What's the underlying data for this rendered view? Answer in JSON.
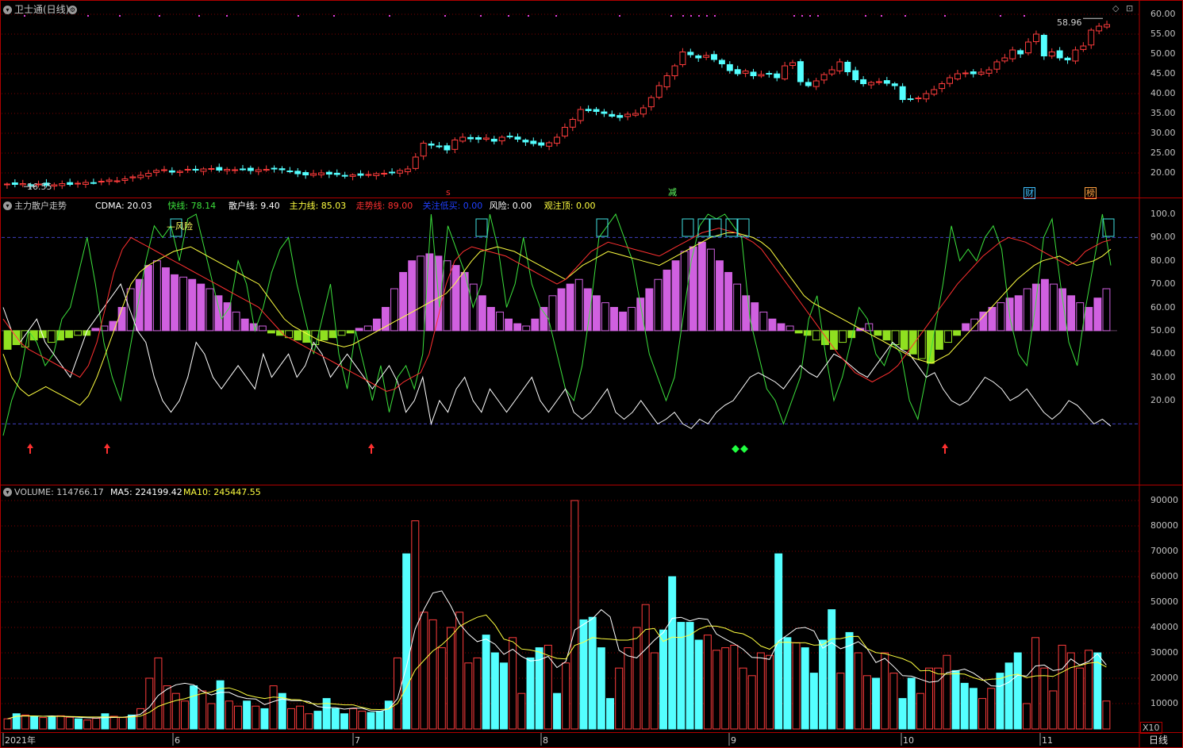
{
  "header": {
    "title": "卫士通(日线)",
    "diamond_icon": "diamond-icon",
    "gear_icon": "gear-icon",
    "max_price_label": "58.96",
    "min_price_label": "16.55"
  },
  "indicator": {
    "name": "主力散户走势",
    "values": [
      {
        "label": "CDMA: 20.03",
        "color": "#ffffff"
      },
      {
        "label": "快线: 78.14",
        "color": "#3ce03c"
      },
      {
        "label": "散户线: 9.40",
        "color": "#ffffff"
      },
      {
        "label": "主力线: 85.03",
        "color": "#ffff40"
      },
      {
        "label": "走势线: 89.00",
        "color": "#ff3030"
      },
      {
        "label": "关注低买: 0.00",
        "color": "#2040ff"
      },
      {
        "label": "风险: 0.00",
        "color": "#ffffff"
      },
      {
        "label": "观注顶: 0.00",
        "color": "#ffff40"
      }
    ],
    "risk_label": "风险"
  },
  "volume": {
    "name": "VOLUME: 114766.17",
    "ma5": "MA5: 224199.42",
    "ma10": "MA10: 245447.55",
    "unit": "X10"
  },
  "markers": {
    "s_label": "s",
    "jian_label": "减",
    "cai_label": "财",
    "bang_label": "榜"
  },
  "footer": {
    "period": "日线",
    "x_labels": [
      "2021年",
      "6",
      "7",
      "8",
      "9",
      "10",
      "11"
    ]
  },
  "colors": {
    "up": "#ff3c3c",
    "down": "#54ffff",
    "magenta": "#d060e0",
    "lime": "#90e020",
    "grid": "#800000",
    "frame": "#b00000"
  },
  "chart_data": [
    {
      "type": "candlestick",
      "title": "卫士通(日线)",
      "yticks": [
        "60.00",
        "55.00",
        "50.00",
        "45.00",
        "40.00",
        "35.00",
        "30.00",
        "25.00",
        "20.00"
      ],
      "ylim": [
        16.0,
        61.0
      ],
      "closes": [
        17.2,
        17.1,
        17.3,
        17.0,
        17.2,
        16.9,
        17.0,
        17.3,
        17.1,
        17.4,
        17.6,
        17.5,
        17.9,
        18.2,
        18.0,
        18.5,
        19.0,
        19.4,
        19.9,
        20.6,
        20.8,
        20.2,
        20.4,
        20.9,
        20.7,
        21.0,
        21.1,
        20.7,
        20.9,
        20.8,
        21.0,
        20.6,
        20.8,
        20.9,
        21.0,
        20.8,
        20.4,
        19.8,
        19.5,
        19.8,
        20.0,
        19.7,
        19.6,
        19.3,
        19.5,
        19.4,
        19.6,
        19.8,
        19.9,
        20.0,
        20.6,
        21.0,
        24.0,
        27.5,
        27.0,
        26.6,
        25.8,
        28.3,
        29.0,
        28.6,
        28.5,
        28.8,
        28.0,
        29.0,
        29.2,
        28.5,
        27.8,
        27.4,
        27.0,
        27.6,
        29.0,
        31.5,
        33.5,
        36.0,
        35.7,
        35.5,
        35.0,
        34.3,
        34.0,
        34.8,
        35.0,
        36.4,
        39.0,
        42.0,
        44.5,
        47.0,
        50.5,
        49.8,
        49.0,
        49.6,
        48.6,
        47.5,
        45.8,
        45.0,
        45.7,
        44.5,
        44.8,
        45.0,
        44.0,
        47.0,
        47.8,
        43.0,
        42.0,
        43.2,
        44.8,
        46.0,
        48.0,
        45.5,
        43.5,
        42.5,
        42.8,
        43.0,
        42.6,
        42.0,
        38.5,
        38.6,
        38.9,
        40.0,
        41.0,
        42.5,
        44.0,
        45.0,
        45.2,
        45.0,
        45.4,
        46.0,
        48.0,
        49.0,
        51.0,
        50.0,
        53.0,
        55.0,
        49.5,
        50.5,
        49.0,
        48.5,
        51.0,
        52.0,
        56.0,
        57.0,
        57.4
      ],
      "last_high": 58.96,
      "first_low": 16.55
    },
    {
      "type": "line",
      "title": "主力散户走势",
      "yticks": [
        "100.0",
        "90.00",
        "80.00",
        "70.00",
        "60.00",
        "50.00",
        "40.00",
        "30.00",
        "20.00"
      ],
      "ylim": [
        0,
        103
      ],
      "series": [
        {
          "name": "快线",
          "values": [
            5,
            20,
            30,
            50,
            45,
            35,
            40,
            55,
            60,
            75,
            90,
            70,
            45,
            30,
            20,
            40,
            60,
            80,
            95,
            90,
            95,
            80,
            98,
            100,
            85,
            70,
            55,
            60,
            80,
            70,
            50,
            60,
            75,
            85,
            90,
            70,
            55,
            40,
            55,
            70,
            40,
            25,
            50,
            35,
            20,
            35,
            15,
            30,
            35,
            25,
            40,
            100,
            60,
            95,
            85,
            75,
            60,
            70,
            100,
            85,
            60,
            70,
            90,
            70,
            60,
            55,
            40,
            25,
            20,
            35,
            60,
            90,
            95,
            100,
            90,
            80,
            60,
            40,
            30,
            20,
            30,
            55,
            80,
            95,
            100,
            98,
            100,
            95,
            90,
            55,
            40,
            25,
            20,
            10,
            20,
            30,
            55,
            65,
            40,
            20,
            30,
            45,
            60,
            55,
            40,
            35,
            45,
            40,
            20,
            12,
            30,
            50,
            70,
            95,
            80,
            85,
            80,
            90,
            95,
            85,
            55,
            40,
            35,
            60,
            90,
            98,
            70,
            45,
            35,
            60,
            80,
            100,
            78
          ]
        },
        {
          "name": "散户线",
          "values": [
            60,
            50,
            45,
            50,
            55,
            45,
            40,
            35,
            30,
            40,
            50,
            55,
            60,
            65,
            70,
            60,
            50,
            45,
            30,
            20,
            15,
            20,
            30,
            45,
            40,
            30,
            25,
            30,
            35,
            30,
            25,
            40,
            30,
            35,
            40,
            30,
            35,
            45,
            40,
            30,
            35,
            40,
            35,
            30,
            25,
            30,
            35,
            28,
            15,
            20,
            30,
            10,
            20,
            15,
            25,
            30,
            20,
            15,
            25,
            20,
            15,
            20,
            25,
            30,
            20,
            15,
            20,
            25,
            15,
            12,
            15,
            20,
            25,
            15,
            12,
            15,
            20,
            15,
            10,
            12,
            15,
            10,
            8,
            12,
            10,
            15,
            18,
            20,
            25,
            30,
            32,
            30,
            28,
            25,
            30,
            35,
            32,
            30,
            35,
            40,
            38,
            35,
            32,
            30,
            35,
            40,
            45,
            42,
            40,
            35,
            30,
            32,
            25,
            20,
            18,
            20,
            25,
            30,
            28,
            25,
            20,
            22,
            25,
            20,
            15,
            12,
            15,
            20,
            18,
            14,
            10,
            12,
            9
          ]
        },
        {
          "name": "主力线",
          "values": [
            40,
            30,
            25,
            22,
            24,
            26,
            24,
            22,
            20,
            18,
            22,
            30,
            40,
            50,
            60,
            70,
            75,
            78,
            80,
            82,
            84,
            85,
            86,
            84,
            82,
            80,
            78,
            76,
            74,
            72,
            70,
            65,
            60,
            55,
            52,
            50,
            48,
            46,
            45,
            44,
            43,
            44,
            46,
            48,
            50,
            52,
            54,
            56,
            58,
            60,
            62,
            64,
            66,
            70,
            75,
            80,
            84,
            85,
            86,
            85,
            84,
            82,
            80,
            78,
            76,
            74,
            72,
            75,
            78,
            80,
            82,
            84,
            83,
            82,
            81,
            80,
            79,
            78,
            80,
            82,
            84,
            86,
            88,
            90,
            91,
            92,
            92,
            91,
            90,
            88,
            85,
            80,
            75,
            70,
            65,
            62,
            60,
            58,
            56,
            54,
            52,
            50,
            48,
            46,
            44,
            42,
            40,
            38,
            37,
            36,
            38,
            40,
            44,
            48,
            52,
            56,
            60,
            64,
            68,
            72,
            75,
            78,
            80,
            81,
            82,
            80,
            78,
            79,
            80,
            82,
            85
          ]
        },
        {
          "name": "走势线",
          "values": [
            55,
            50,
            45,
            42,
            40,
            38,
            36,
            34,
            32,
            30,
            35,
            45,
            60,
            75,
            85,
            90,
            88,
            86,
            84,
            82,
            80,
            78,
            76,
            74,
            72,
            70,
            68,
            66,
            64,
            62,
            60,
            56,
            52,
            48,
            46,
            44,
            42,
            40,
            38,
            36,
            34,
            32,
            30,
            28,
            26,
            24,
            25,
            28,
            30,
            32,
            40,
            55,
            70,
            80,
            84,
            86,
            85,
            84,
            83,
            82,
            80,
            78,
            76,
            74,
            72,
            70,
            72,
            76,
            80,
            84,
            86,
            88,
            87,
            86,
            85,
            84,
            83,
            82,
            84,
            86,
            88,
            90,
            92,
            93,
            94,
            93,
            92,
            90,
            88,
            85,
            80,
            75,
            70,
            65,
            60,
            55,
            50,
            45,
            40,
            36,
            32,
            30,
            28,
            30,
            32,
            35,
            40,
            45,
            50,
            55,
            60,
            65,
            70,
            74,
            78,
            82,
            85,
            88,
            90,
            89,
            88,
            86,
            84,
            82,
            80,
            78,
            80,
            84,
            86,
            88,
            89
          ]
        }
      ],
      "bars": [
        -8,
        -6,
        -7,
        -4,
        -3,
        -5,
        -4,
        -3,
        -2,
        -2,
        1,
        2,
        4,
        10,
        18,
        22,
        28,
        30,
        27,
        24,
        23,
        22,
        20,
        18,
        15,
        12,
        8,
        5,
        3,
        2,
        -1,
        -2,
        -3,
        -4,
        -5,
        -6,
        -4,
        -3,
        -2,
        -1,
        1,
        2,
        5,
        10,
        18,
        25,
        30,
        32,
        33,
        32,
        30,
        28,
        25,
        20,
        15,
        10,
        8,
        5,
        3,
        2,
        5,
        10,
        15,
        18,
        20,
        22,
        18,
        15,
        12,
        10,
        8,
        10,
        14,
        18,
        22,
        26,
        30,
        34,
        36,
        38,
        35,
        30,
        25,
        20,
        15,
        12,
        8,
        5,
        3,
        2,
        -1,
        -2,
        -4,
        -6,
        -8,
        -5,
        -3,
        1,
        3,
        -2,
        -4,
        -6,
        -8,
        -10,
        -12,
        -14,
        -8,
        -5,
        -2,
        3,
        5,
        8,
        10,
        12,
        14,
        15,
        18,
        20,
        22,
        20,
        18,
        15,
        12,
        10,
        14,
        18
      ],
      "reference_lines": [
        90,
        10
      ]
    },
    {
      "type": "bar",
      "title": "VOLUME",
      "yticks": [
        "90000",
        "80000",
        "70000",
        "60000",
        "50000",
        "40000",
        "30000",
        "20000",
        "10000"
      ],
      "ylim": [
        0,
        92000
      ],
      "values": [
        4000,
        6000,
        5500,
        5000,
        4500,
        4800,
        5200,
        4600,
        4000,
        3500,
        4200,
        6000,
        5000,
        4500,
        5500,
        8000,
        20000,
        28000,
        17000,
        14000,
        11000,
        17000,
        15000,
        10000,
        19000,
        11000,
        9000,
        11000,
        9000,
        8000,
        17000,
        14000,
        8000,
        9000,
        6000,
        7000,
        12000,
        8000,
        6000,
        8000,
        7000,
        6500,
        7000,
        11000,
        28000,
        69000,
        82000,
        46000,
        43000,
        32000,
        40000,
        46000,
        26000,
        28000,
        37000,
        30000,
        26000,
        36000,
        14000,
        28000,
        32000,
        33000,
        14000,
        26000,
        90000,
        43000,
        44000,
        32000,
        12000,
        24000,
        32000,
        40000,
        49000,
        30000,
        39000,
        60000,
        42000,
        42000,
        35000,
        37000,
        31000,
        32000,
        33000,
        24000,
        21000,
        30000,
        29000,
        69000,
        36000,
        34000,
        32000,
        22000,
        35000,
        47000,
        22000,
        38000,
        30000,
        21000,
        20000,
        30000,
        22000,
        12000,
        20000,
        14000,
        24000,
        24000,
        29000,
        23000,
        18000,
        16000,
        12000,
        16000,
        22000,
        26000,
        30000,
        10000,
        36000,
        24000,
        15000,
        33000,
        30000,
        24000,
        31000,
        30000,
        11000
      ],
      "ma5_last": 224199.42,
      "ma10_last": 245447.55
    }
  ]
}
